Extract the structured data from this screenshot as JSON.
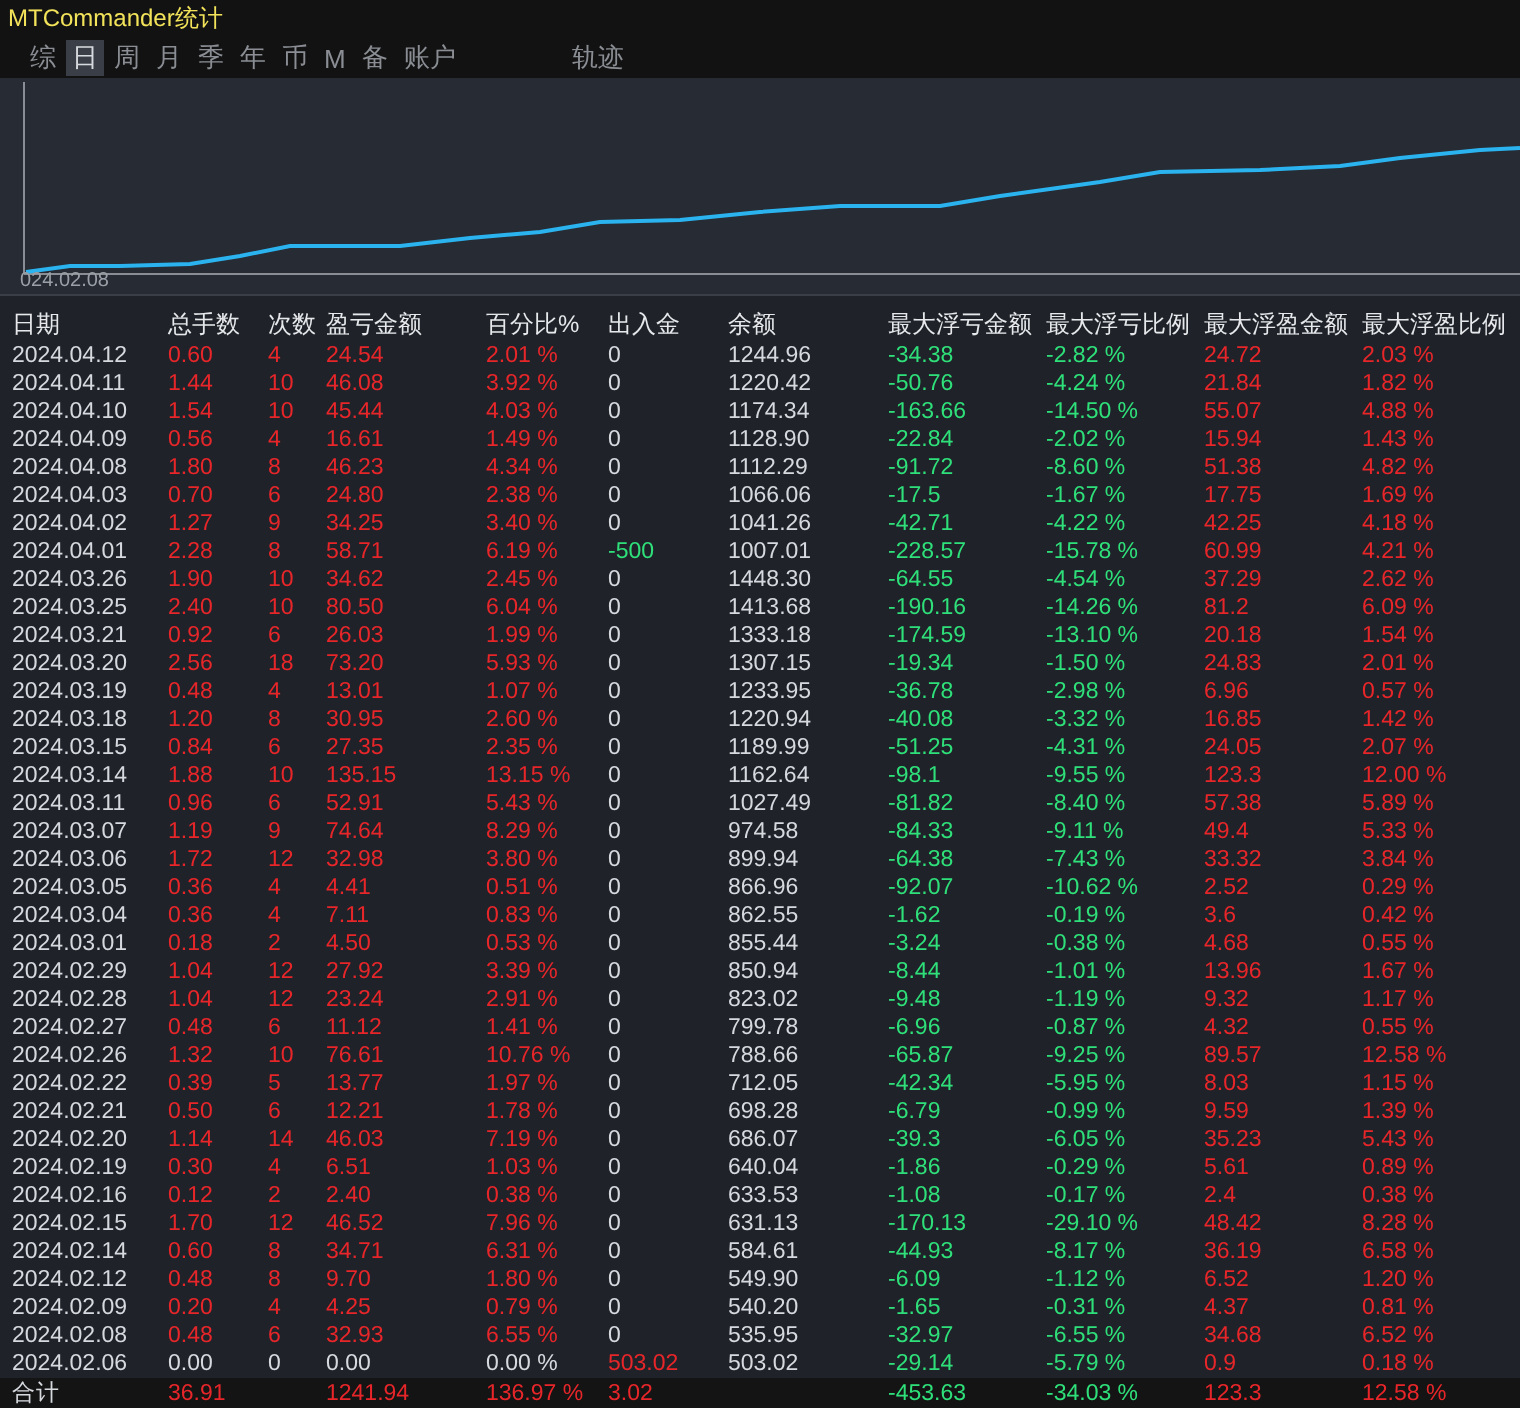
{
  "window": {
    "title": "MTCommander统计"
  },
  "tabs": [
    {
      "label": "综",
      "selected": false
    },
    {
      "label": "日",
      "selected": true
    },
    {
      "label": "周",
      "selected": false
    },
    {
      "label": "月",
      "selected": false
    },
    {
      "label": "季",
      "selected": false
    },
    {
      "label": "年",
      "selected": false
    },
    {
      "label": "币",
      "selected": false
    },
    {
      "label": "M",
      "selected": false
    },
    {
      "label": "备",
      "selected": false
    },
    {
      "label": "账户",
      "selected": false
    }
  ],
  "extra_tabs": [
    {
      "label": "轨迹",
      "selected": false
    }
  ],
  "chart": {
    "start_label": "024.02.08"
  },
  "table": {
    "columns": [
      "日期",
      "总手数",
      "次数",
      "盈亏金额",
      "百分比%",
      "出入金",
      "余额",
      "最大浮亏金额",
      "最大浮亏比例",
      "最大浮盈金额",
      "最大浮盈比例"
    ],
    "rows": [
      {
        "idle": false,
        "inflow": false,
        "outflow": false,
        "cells": [
          "2024.04.12",
          "0.60",
          "4",
          "24.54",
          "2.01 %",
          "0",
          "1244.96",
          "-34.38",
          "-2.82 %",
          "24.72",
          "2.03 %"
        ]
      },
      {
        "idle": false,
        "inflow": false,
        "outflow": false,
        "cells": [
          "2024.04.11",
          "1.44",
          "10",
          "46.08",
          "3.92 %",
          "0",
          "1220.42",
          "-50.76",
          "-4.24 %",
          "21.84",
          "1.82 %"
        ]
      },
      {
        "idle": false,
        "inflow": false,
        "outflow": false,
        "cells": [
          "2024.04.10",
          "1.54",
          "10",
          "45.44",
          "4.03 %",
          "0",
          "1174.34",
          "-163.66",
          "-14.50 %",
          "55.07",
          "4.88 %"
        ]
      },
      {
        "idle": false,
        "inflow": false,
        "outflow": false,
        "cells": [
          "2024.04.09",
          "0.56",
          "4",
          "16.61",
          "1.49 %",
          "0",
          "1128.90",
          "-22.84",
          "-2.02 %",
          "15.94",
          "1.43 %"
        ]
      },
      {
        "idle": false,
        "inflow": false,
        "outflow": false,
        "cells": [
          "2024.04.08",
          "1.80",
          "8",
          "46.23",
          "4.34 %",
          "0",
          "1112.29",
          "-91.72",
          "-8.60 %",
          "51.38",
          "4.82 %"
        ]
      },
      {
        "idle": false,
        "inflow": false,
        "outflow": false,
        "cells": [
          "2024.04.03",
          "0.70",
          "6",
          "24.80",
          "2.38 %",
          "0",
          "1066.06",
          "-17.5",
          "-1.67 %",
          "17.75",
          "1.69 %"
        ]
      },
      {
        "idle": false,
        "inflow": false,
        "outflow": false,
        "cells": [
          "2024.04.02",
          "1.27",
          "9",
          "34.25",
          "3.40 %",
          "0",
          "1041.26",
          "-42.71",
          "-4.22 %",
          "42.25",
          "4.18 %"
        ]
      },
      {
        "idle": false,
        "inflow": false,
        "outflow": true,
        "cells": [
          "2024.04.01",
          "2.28",
          "8",
          "58.71",
          "6.19 %",
          "-500",
          "1007.01",
          "-228.57",
          "-15.78 %",
          "60.99",
          "4.21 %"
        ]
      },
      {
        "idle": false,
        "inflow": false,
        "outflow": false,
        "cells": [
          "2024.03.26",
          "1.90",
          "10",
          "34.62",
          "2.45 %",
          "0",
          "1448.30",
          "-64.55",
          "-4.54 %",
          "37.29",
          "2.62 %"
        ]
      },
      {
        "idle": false,
        "inflow": false,
        "outflow": false,
        "cells": [
          "2024.03.25",
          "2.40",
          "10",
          "80.50",
          "6.04 %",
          "0",
          "1413.68",
          "-190.16",
          "-14.26 %",
          "81.2",
          "6.09 %"
        ]
      },
      {
        "idle": false,
        "inflow": false,
        "outflow": false,
        "cells": [
          "2024.03.21",
          "0.92",
          "6",
          "26.03",
          "1.99 %",
          "0",
          "1333.18",
          "-174.59",
          "-13.10 %",
          "20.18",
          "1.54 %"
        ]
      },
      {
        "idle": false,
        "inflow": false,
        "outflow": false,
        "cells": [
          "2024.03.20",
          "2.56",
          "18",
          "73.20",
          "5.93 %",
          "0",
          "1307.15",
          "-19.34",
          "-1.50 %",
          "24.83",
          "2.01 %"
        ]
      },
      {
        "idle": false,
        "inflow": false,
        "outflow": false,
        "cells": [
          "2024.03.19",
          "0.48",
          "4",
          "13.01",
          "1.07 %",
          "0",
          "1233.95",
          "-36.78",
          "-2.98 %",
          "6.96",
          "0.57 %"
        ]
      },
      {
        "idle": false,
        "inflow": false,
        "outflow": false,
        "cells": [
          "2024.03.18",
          "1.20",
          "8",
          "30.95",
          "2.60 %",
          "0",
          "1220.94",
          "-40.08",
          "-3.32 %",
          "16.85",
          "1.42 %"
        ]
      },
      {
        "idle": false,
        "inflow": false,
        "outflow": false,
        "cells": [
          "2024.03.15",
          "0.84",
          "6",
          "27.35",
          "2.35 %",
          "0",
          "1189.99",
          "-51.25",
          "-4.31 %",
          "24.05",
          "2.07 %"
        ]
      },
      {
        "idle": false,
        "inflow": false,
        "outflow": false,
        "cells": [
          "2024.03.14",
          "1.88",
          "10",
          "135.15",
          "13.15 %",
          "0",
          "1162.64",
          "-98.1",
          "-9.55 %",
          "123.3",
          "12.00 %"
        ]
      },
      {
        "idle": false,
        "inflow": false,
        "outflow": false,
        "cells": [
          "2024.03.11",
          "0.96",
          "6",
          "52.91",
          "5.43 %",
          "0",
          "1027.49",
          "-81.82",
          "-8.40 %",
          "57.38",
          "5.89 %"
        ]
      },
      {
        "idle": false,
        "inflow": false,
        "outflow": false,
        "cells": [
          "2024.03.07",
          "1.19",
          "9",
          "74.64",
          "8.29 %",
          "0",
          "974.58",
          "-84.33",
          "-9.11 %",
          "49.4",
          "5.33 %"
        ]
      },
      {
        "idle": false,
        "inflow": false,
        "outflow": false,
        "cells": [
          "2024.03.06",
          "1.72",
          "12",
          "32.98",
          "3.80 %",
          "0",
          "899.94",
          "-64.38",
          "-7.43 %",
          "33.32",
          "3.84 %"
        ]
      },
      {
        "idle": false,
        "inflow": false,
        "outflow": false,
        "cells": [
          "2024.03.05",
          "0.36",
          "4",
          "4.41",
          "0.51 %",
          "0",
          "866.96",
          "-92.07",
          "-10.62 %",
          "2.52",
          "0.29 %"
        ]
      },
      {
        "idle": false,
        "inflow": false,
        "outflow": false,
        "cells": [
          "2024.03.04",
          "0.36",
          "4",
          "7.11",
          "0.83 %",
          "0",
          "862.55",
          "-1.62",
          "-0.19 %",
          "3.6",
          "0.42 %"
        ]
      },
      {
        "idle": false,
        "inflow": false,
        "outflow": false,
        "cells": [
          "2024.03.01",
          "0.18",
          "2",
          "4.50",
          "0.53 %",
          "0",
          "855.44",
          "-3.24",
          "-0.38 %",
          "4.68",
          "0.55 %"
        ]
      },
      {
        "idle": false,
        "inflow": false,
        "outflow": false,
        "cells": [
          "2024.02.29",
          "1.04",
          "12",
          "27.92",
          "3.39 %",
          "0",
          "850.94",
          "-8.44",
          "-1.01 %",
          "13.96",
          "1.67 %"
        ]
      },
      {
        "idle": false,
        "inflow": false,
        "outflow": false,
        "cells": [
          "2024.02.28",
          "1.04",
          "12",
          "23.24",
          "2.91 %",
          "0",
          "823.02",
          "-9.48",
          "-1.19 %",
          "9.32",
          "1.17 %"
        ]
      },
      {
        "idle": false,
        "inflow": false,
        "outflow": false,
        "cells": [
          "2024.02.27",
          "0.48",
          "6",
          "11.12",
          "1.41 %",
          "0",
          "799.78",
          "-6.96",
          "-0.87 %",
          "4.32",
          "0.55 %"
        ]
      },
      {
        "idle": false,
        "inflow": false,
        "outflow": false,
        "cells": [
          "2024.02.26",
          "1.32",
          "10",
          "76.61",
          "10.76 %",
          "0",
          "788.66",
          "-65.87",
          "-9.25 %",
          "89.57",
          "12.58 %"
        ]
      },
      {
        "idle": false,
        "inflow": false,
        "outflow": false,
        "cells": [
          "2024.02.22",
          "0.39",
          "5",
          "13.77",
          "1.97 %",
          "0",
          "712.05",
          "-42.34",
          "-5.95 %",
          "8.03",
          "1.15 %"
        ]
      },
      {
        "idle": false,
        "inflow": false,
        "outflow": false,
        "cells": [
          "2024.02.21",
          "0.50",
          "6",
          "12.21",
          "1.78 %",
          "0",
          "698.28",
          "-6.79",
          "-0.99 %",
          "9.59",
          "1.39 %"
        ]
      },
      {
        "idle": false,
        "inflow": false,
        "outflow": false,
        "cells": [
          "2024.02.20",
          "1.14",
          "14",
          "46.03",
          "7.19 %",
          "0",
          "686.07",
          "-39.3",
          "-6.05 %",
          "35.23",
          "5.43 %"
        ]
      },
      {
        "idle": false,
        "inflow": false,
        "outflow": false,
        "cells": [
          "2024.02.19",
          "0.30",
          "4",
          "6.51",
          "1.03 %",
          "0",
          "640.04",
          "-1.86",
          "-0.29 %",
          "5.61",
          "0.89 %"
        ]
      },
      {
        "idle": false,
        "inflow": false,
        "outflow": false,
        "cells": [
          "2024.02.16",
          "0.12",
          "2",
          "2.40",
          "0.38 %",
          "0",
          "633.53",
          "-1.08",
          "-0.17 %",
          "2.4",
          "0.38 %"
        ]
      },
      {
        "idle": false,
        "inflow": false,
        "outflow": false,
        "cells": [
          "2024.02.15",
          "1.70",
          "12",
          "46.52",
          "7.96 %",
          "0",
          "631.13",
          "-170.13",
          "-29.10 %",
          "48.42",
          "8.28 %"
        ]
      },
      {
        "idle": false,
        "inflow": false,
        "outflow": false,
        "cells": [
          "2024.02.14",
          "0.60",
          "8",
          "34.71",
          "6.31 %",
          "0",
          "584.61",
          "-44.93",
          "-8.17 %",
          "36.19",
          "6.58 %"
        ]
      },
      {
        "idle": false,
        "inflow": false,
        "outflow": false,
        "cells": [
          "2024.02.12",
          "0.48",
          "8",
          "9.70",
          "1.80 %",
          "0",
          "549.90",
          "-6.09",
          "-1.12 %",
          "6.52",
          "1.20 %"
        ]
      },
      {
        "idle": false,
        "inflow": false,
        "outflow": false,
        "cells": [
          "2024.02.09",
          "0.20",
          "4",
          "4.25",
          "0.79 %",
          "0",
          "540.20",
          "-1.65",
          "-0.31 %",
          "4.37",
          "0.81 %"
        ]
      },
      {
        "idle": false,
        "inflow": false,
        "outflow": false,
        "cells": [
          "2024.02.08",
          "0.48",
          "6",
          "32.93",
          "6.55 %",
          "0",
          "535.95",
          "-32.97",
          "-6.55 %",
          "34.68",
          "6.52 %"
        ]
      },
      {
        "idle": true,
        "inflow": true,
        "outflow": false,
        "cells": [
          "2024.02.06",
          "0.00",
          "0",
          "0.00",
          "0.00 %",
          "503.02",
          "503.02",
          "-29.14",
          "-5.79 %",
          "0.9",
          "0.18 %"
        ]
      }
    ],
    "total": {
      "label": "合计",
      "lots": "36.91",
      "pnl": "1241.94",
      "percent": "136.97 %",
      "deposit": "3.02",
      "max_loss": "-453.63",
      "max_loss_percent": "-34.03 %",
      "max_gain": "123.3",
      "max_gain_percent": "12.58 %"
    }
  }
}
